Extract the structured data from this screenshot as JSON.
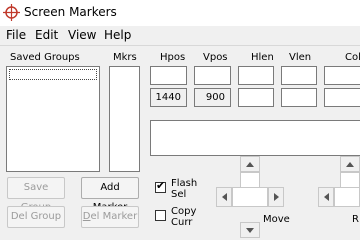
{
  "window": {
    "title": "Screen Markers"
  },
  "menu": [
    "File",
    "Edit",
    "View",
    "Help"
  ],
  "saved_groups": {
    "label": "Saved Groups"
  },
  "markers": {
    "label": "Mkrs"
  },
  "columns": {
    "hpos": "Hpos",
    "vpos": "Vpos",
    "hlen": "Hlen",
    "vlen": "Vlen",
    "color": "Colo"
  },
  "readouts": {
    "hpos": "1440",
    "vpos": "900"
  },
  "buttons": {
    "save_group": {
      "pre": "Save ",
      "ul": "G",
      "post": "roup"
    },
    "del_group": {
      "pre": "Del Group",
      "ul": "",
      "post": ""
    },
    "add_marker": {
      "pre": "Add ",
      "ul": "M",
      "post": "arker"
    },
    "del_marker": {
      "pre": "",
      "ul": "D",
      "post": "el Marker"
    }
  },
  "checkboxes": {
    "flash_sel": {
      "line1": "Flash",
      "line2": "Sel",
      "checked": true,
      "mark": "✔"
    },
    "copy_curr": {
      "line1": "Copy",
      "line2": "Curr",
      "checked": false
    }
  },
  "move_label": "Move",
  "resize_label": "R"
}
